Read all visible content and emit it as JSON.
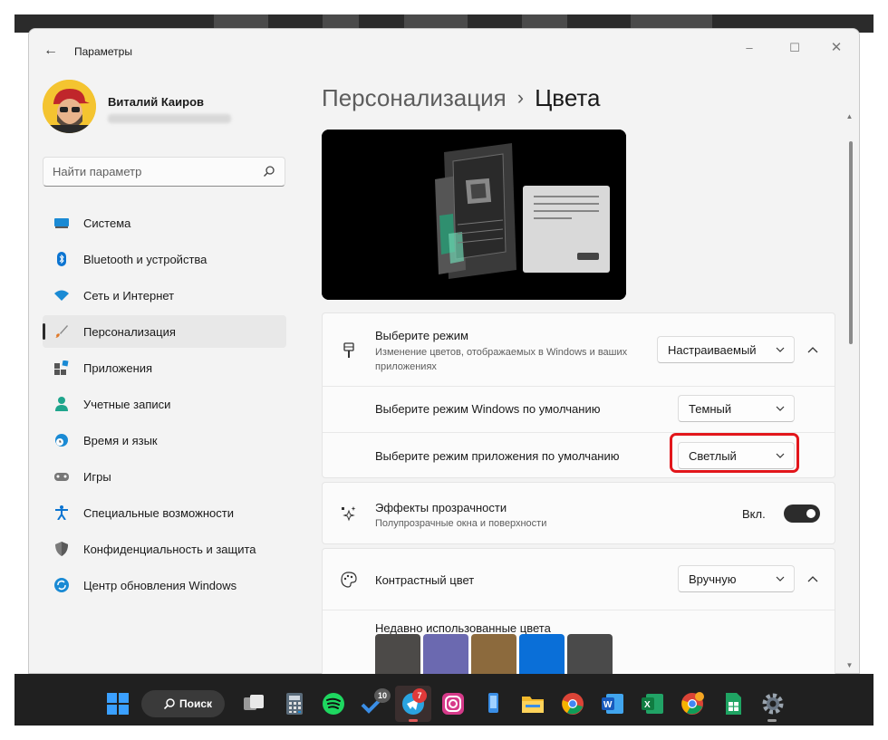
{
  "window": {
    "title": "Параметры"
  },
  "profile": {
    "name": "Виталий Каиров"
  },
  "search": {
    "placeholder": "Найти параметр"
  },
  "sidebar": {
    "items": [
      {
        "label": "Система",
        "icon": "monitor-icon"
      },
      {
        "label": "Bluetooth и устройства",
        "icon": "bluetooth-icon"
      },
      {
        "label": "Сеть и Интернет",
        "icon": "wifi-icon"
      },
      {
        "label": "Персонализация",
        "icon": "brush-icon",
        "active": true
      },
      {
        "label": "Приложения",
        "icon": "apps-icon"
      },
      {
        "label": "Учетные записи",
        "icon": "person-icon"
      },
      {
        "label": "Время и язык",
        "icon": "globe-clock-icon"
      },
      {
        "label": "Игры",
        "icon": "gamepad-icon"
      },
      {
        "label": "Специальные возможности",
        "icon": "accessibility-icon"
      },
      {
        "label": "Конфиденциальность и защита",
        "icon": "shield-icon"
      },
      {
        "label": "Центр обновления Windows",
        "icon": "update-icon"
      }
    ]
  },
  "breadcrumb": {
    "parent": "Персонализация",
    "separator": "›",
    "current": "Цвета"
  },
  "mode": {
    "title": "Выберите режим",
    "description": "Изменение цветов, отображаемых в Windows и ваших приложениях",
    "value": "Настраиваемый",
    "windows_mode_label": "Выберите режим Windows по умолчанию",
    "windows_mode_value": "Темный",
    "app_mode_label": "Выберите режим приложения по умолчанию",
    "app_mode_value": "Светлый"
  },
  "transparency": {
    "title": "Эффекты прозрачности",
    "description": "Полупрозрачные окна и поверхности",
    "state_label": "Вкл.",
    "enabled": true
  },
  "accent": {
    "title": "Контрастный цвет",
    "value": "Вручную",
    "recent_label": "Недавно использованные цвета",
    "recent_colors": [
      "#4c4a48",
      "#6b69b0",
      "#8c6a3d",
      "#0a6fd8",
      "#4a4a4a"
    ]
  },
  "taskbar": {
    "search_label": "Поиск",
    "badges": {
      "todo": "10",
      "telegram": "7"
    }
  },
  "colors": {
    "accent": "#0067c0",
    "highlight": "#e2161b",
    "toggle_on": "#2c2c2c"
  }
}
